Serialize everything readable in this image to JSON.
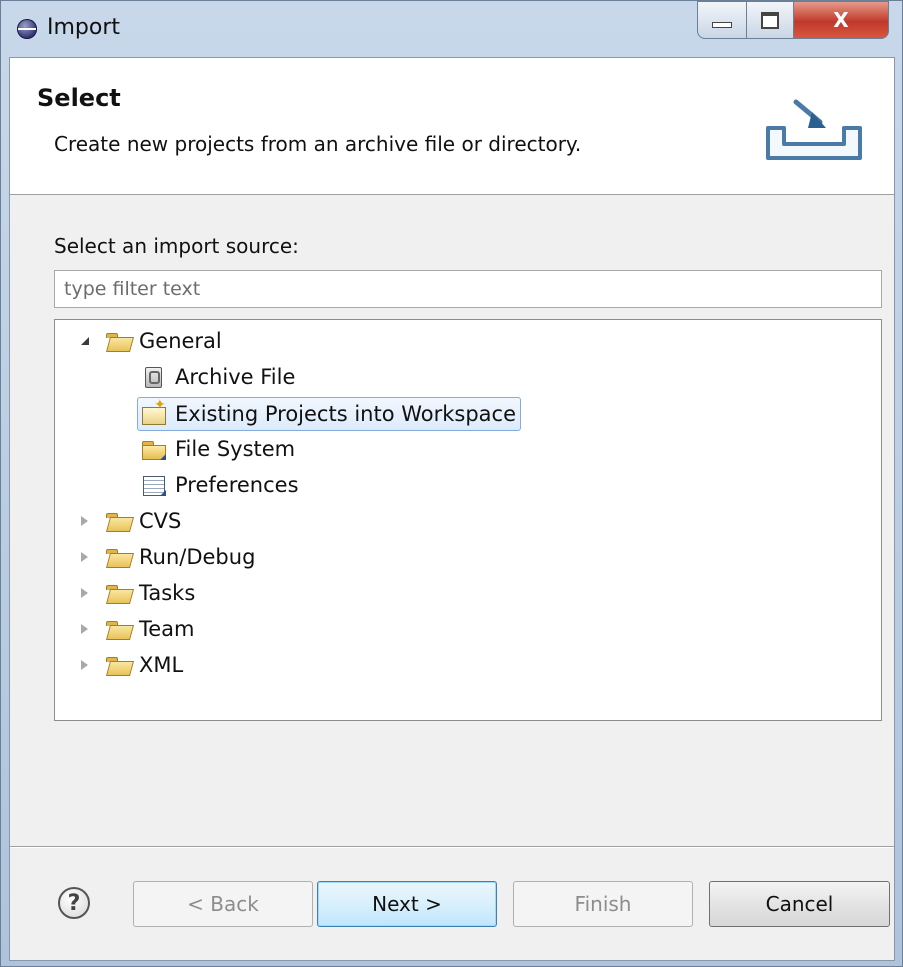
{
  "window": {
    "title": "Import"
  },
  "header": {
    "title": "Select",
    "description": "Create new projects from an archive file or directory."
  },
  "source": {
    "label": "Select an import source:",
    "filter_placeholder": "type filter text",
    "filter_value": ""
  },
  "tree": {
    "general": "General",
    "archive_file": "Archive File",
    "existing_projects": "Existing Projects into Workspace",
    "file_system": "File System",
    "preferences": "Preferences",
    "cvs": "CVS",
    "run_debug": "Run/Debug",
    "tasks": "Tasks",
    "team": "Team",
    "xml": "XML",
    "selected_item": "Existing Projects into Workspace",
    "expanded": [
      "General"
    ]
  },
  "buttons": {
    "help": "?",
    "back": "< Back",
    "next": "Next >",
    "finish": "Finish",
    "cancel": "Cancel",
    "close": "X"
  },
  "icons": {
    "app": "eclipse-icon",
    "header": "import-wizard-icon",
    "help": "help-icon"
  }
}
